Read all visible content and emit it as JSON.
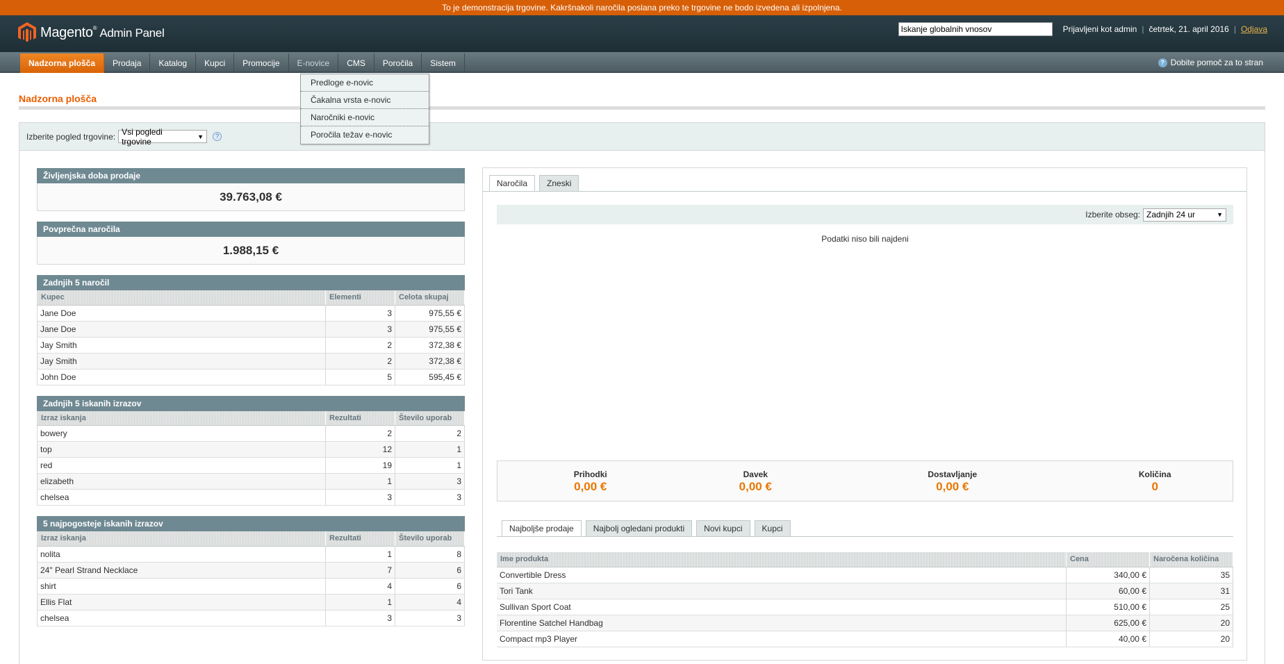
{
  "demo_notice": "To je demonstracija trgovine. Kakršnakoli naročila poslana preko te trgovine ne bodo izvedena ali izpolnjena.",
  "header": {
    "logo_text": "Magento",
    "logo_sub": "Admin Panel",
    "search_value": "Iskanje globalnih vnosov",
    "logged_in": "Prijavljeni kot admin",
    "date": "četrtek, 21. april 2016",
    "logout": "Odjava"
  },
  "nav": {
    "items": [
      "Nadzorna plošča",
      "Prodaja",
      "Katalog",
      "Kupci",
      "Promocije",
      "E-novice",
      "CMS",
      "Poročila",
      "Sistem"
    ],
    "help": "Dobite pomoč za to stran"
  },
  "dropdown": [
    "Predloge e-novic",
    "Čakalna vrsta e-novic",
    "Naročniki e-novic",
    "Poročila težav e-novic"
  ],
  "page_title": "Nadzorna plošča",
  "store_switcher": {
    "label": "Izberite pogled trgovine:",
    "value": "Vsi pogledi trgovine"
  },
  "lifetime_sales": {
    "title": "Življenjska doba prodaje",
    "value": "39.763,08 €"
  },
  "avg_orders": {
    "title": "Povprečna naročila",
    "value": "1.988,15 €"
  },
  "last_orders": {
    "title": "Zadnjih 5 naročil",
    "columns": [
      "Kupec",
      "Elementi",
      "Celota skupaj"
    ],
    "rows": [
      [
        "Jane Doe",
        "3",
        "975,55 €"
      ],
      [
        "Jane Doe",
        "3",
        "975,55 €"
      ],
      [
        "Jay Smith",
        "2",
        "372,38 €"
      ],
      [
        "Jay Smith",
        "2",
        "372,38 €"
      ],
      [
        "John Doe",
        "5",
        "595,45 €"
      ]
    ]
  },
  "last_searches": {
    "title": "Zadnjih 5 iskanih izrazov",
    "columns": [
      "Izraz iskanja",
      "Rezultati",
      "Število uporab"
    ],
    "rows": [
      [
        "bowery",
        "2",
        "2"
      ],
      [
        "top",
        "12",
        "1"
      ],
      [
        "red",
        "19",
        "1"
      ],
      [
        "elizabeth",
        "1",
        "3"
      ],
      [
        "chelsea",
        "3",
        "3"
      ]
    ]
  },
  "top_searches": {
    "title": "5 najpogosteje iskanih izrazov",
    "columns": [
      "Izraz iskanja",
      "Rezultati",
      "Število uporab"
    ],
    "rows": [
      [
        "nolita",
        "1",
        "8"
      ],
      [
        "24\" Pearl Strand Necklace",
        "7",
        "6"
      ],
      [
        "shirt",
        "4",
        "6"
      ],
      [
        "Ellis Flat",
        "1",
        "4"
      ],
      [
        "chelsea",
        "3",
        "3"
      ]
    ]
  },
  "chart_tabs": [
    "Naročila",
    "Zneski"
  ],
  "range": {
    "label": "Izberite obseg:",
    "value": "Zadnjih 24 ur"
  },
  "no_data": "Podatki niso bili najdeni",
  "totals": [
    {
      "label": "Prihodki",
      "value": "0,00 €"
    },
    {
      "label": "Davek",
      "value": "0,00 €"
    },
    {
      "label": "Dostavljanje",
      "value": "0,00 €"
    },
    {
      "label": "Količina",
      "value": "0"
    }
  ],
  "bottom_tabs": [
    "Najboljše prodaje",
    "Najbolj ogledani produkti",
    "Novi kupci",
    "Kupci"
  ],
  "bestsellers": {
    "columns": [
      "Ime produkta",
      "Cena",
      "Naročena količina"
    ],
    "rows": [
      [
        "Convertible Dress",
        "340,00 €",
        "35"
      ],
      [
        "Tori Tank",
        "60,00 €",
        "31"
      ],
      [
        "Sullivan Sport Coat",
        "510,00 €",
        "25"
      ],
      [
        "Florentine Satchel Handbag",
        "625,00 €",
        "20"
      ],
      [
        "Compact mp3 Player",
        "40,00 €",
        "20"
      ]
    ]
  },
  "colors": {
    "accent": "#eb5e00",
    "header_bg": "#2b3f48",
    "box_head": "#6f8992",
    "value_orange": "#ea7601"
  }
}
